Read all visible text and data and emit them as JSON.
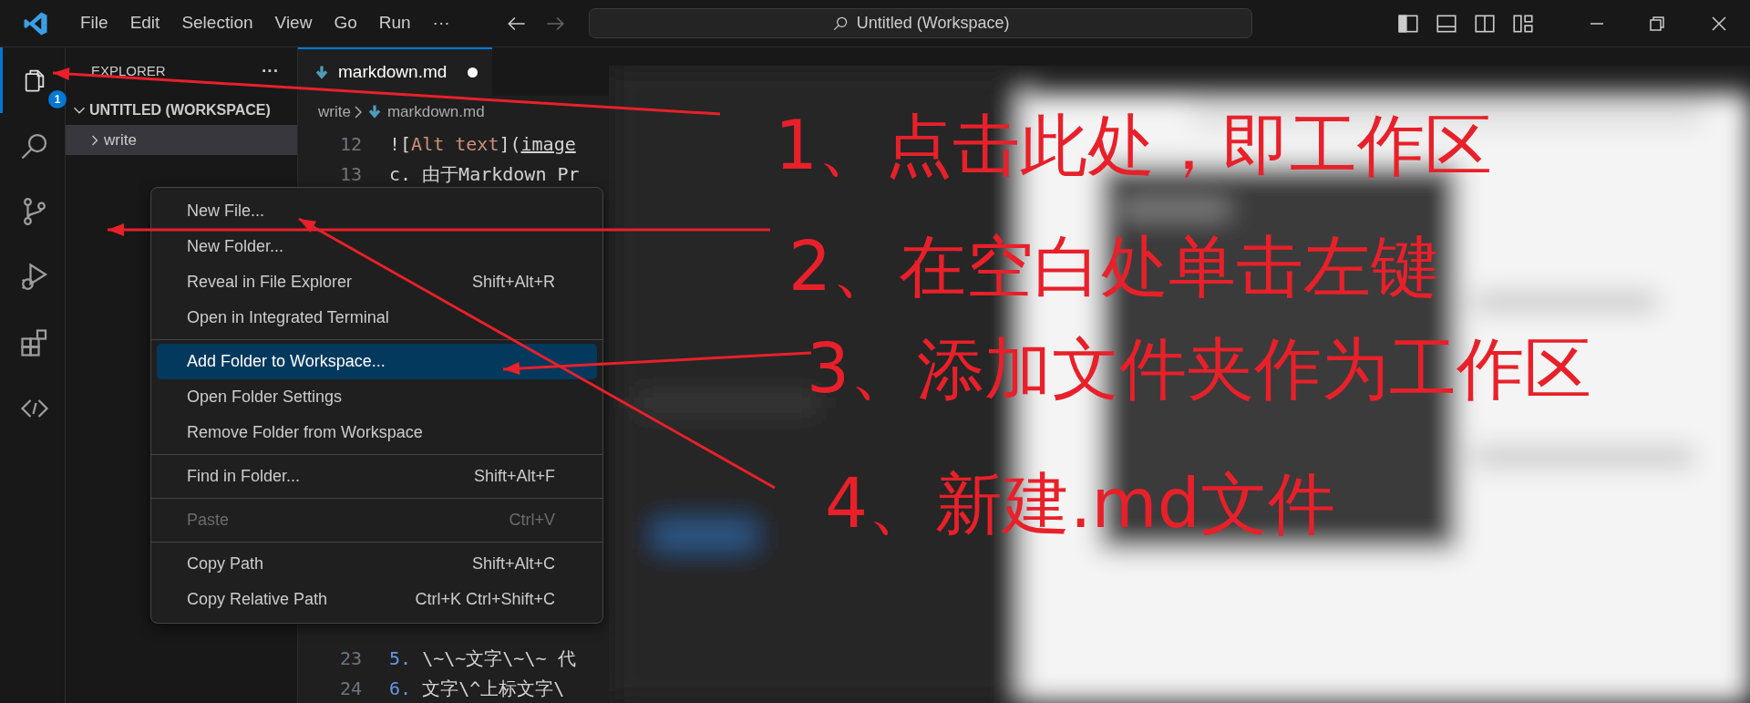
{
  "title_bar": {
    "menu": [
      "File",
      "Edit",
      "Selection",
      "View",
      "Go",
      "Run",
      "···"
    ],
    "search": "Untitled (Workspace)"
  },
  "activity_bar": {
    "items": [
      {
        "kind": "explorer",
        "selected": true,
        "badge": "1"
      },
      {
        "kind": "search",
        "selected": false
      },
      {
        "kind": "source-control",
        "selected": false
      },
      {
        "kind": "run-debug",
        "selected": false
      },
      {
        "kind": "extensions",
        "selected": false
      },
      {
        "kind": "remote",
        "selected": false
      }
    ]
  },
  "sidebar": {
    "title": "EXPLORER",
    "more": "···",
    "workspace": {
      "label": "UNTITLED (WORKSPACE)",
      "expanded": true
    },
    "folders": [
      {
        "label": "write",
        "expanded": false,
        "selected": true
      }
    ]
  },
  "editor": {
    "tabs": [
      {
        "label": "markdown.md",
        "modified": true,
        "selected": true
      }
    ],
    "breadcrumb": [
      "write",
      "markdown.md"
    ],
    "top_lines": [
      {
        "number": "12",
        "segments": [
          {
            "text": "![",
            "kind": "plain"
          },
          {
            "text": "Alt text",
            "kind": "string"
          },
          {
            "text": "](",
            "kind": "plain"
          },
          {
            "text": "image",
            "kind": "link"
          }
        ]
      },
      {
        "number": "13",
        "segments": [
          {
            "text": "c. 由于Markdown Pr",
            "kind": "plain"
          }
        ]
      }
    ],
    "bottom_lines": [
      {
        "number": "23",
        "segments": [
          {
            "text": "5.",
            "kind": "number"
          },
          {
            "text": " \\~\\~文字\\~\\~ 代",
            "kind": "plain"
          }
        ]
      },
      {
        "number": "24",
        "segments": [
          {
            "text": "6.",
            "kind": "number"
          },
          {
            "text": " 文字\\^上标文字\\",
            "kind": "plain"
          }
        ]
      }
    ]
  },
  "context_menu": {
    "groups": [
      [
        {
          "label": "New File...",
          "selected": false,
          "disabled": false
        },
        {
          "label": "New Folder...",
          "selected": false,
          "disabled": false
        },
        {
          "label": "Reveal in File Explorer",
          "shortcut": "Shift+Alt+R",
          "selected": false,
          "disabled": false
        },
        {
          "label": "Open in Integrated Terminal",
          "selected": false,
          "disabled": false
        }
      ],
      [
        {
          "label": "Add Folder to Workspace...",
          "selected": true,
          "disabled": false
        },
        {
          "label": "Open Folder Settings",
          "selected": false,
          "disabled": false
        },
        {
          "label": "Remove Folder from Workspace",
          "selected": false,
          "disabled": false
        }
      ],
      [
        {
          "label": "Find in Folder...",
          "shortcut": "Shift+Alt+F",
          "selected": false,
          "disabled": false
        }
      ],
      [
        {
          "label": "Paste",
          "shortcut": "Ctrl+V",
          "selected": false,
          "disabled": true
        }
      ],
      [
        {
          "label": "Copy Path",
          "shortcut": "Shift+Alt+C",
          "selected": false,
          "disabled": false
        },
        {
          "label": "Copy Relative Path",
          "shortcut": "Ctrl+K Ctrl+Shift+C",
          "selected": false,
          "disabled": false
        }
      ]
    ]
  },
  "annotations": [
    {
      "text": "1、点击此处，即工作区"
    },
    {
      "text": "2、在空白处单击左键"
    },
    {
      "text": "3、添加文件夹作为工作区"
    },
    {
      "text": "4、新建.md文件"
    }
  ]
}
